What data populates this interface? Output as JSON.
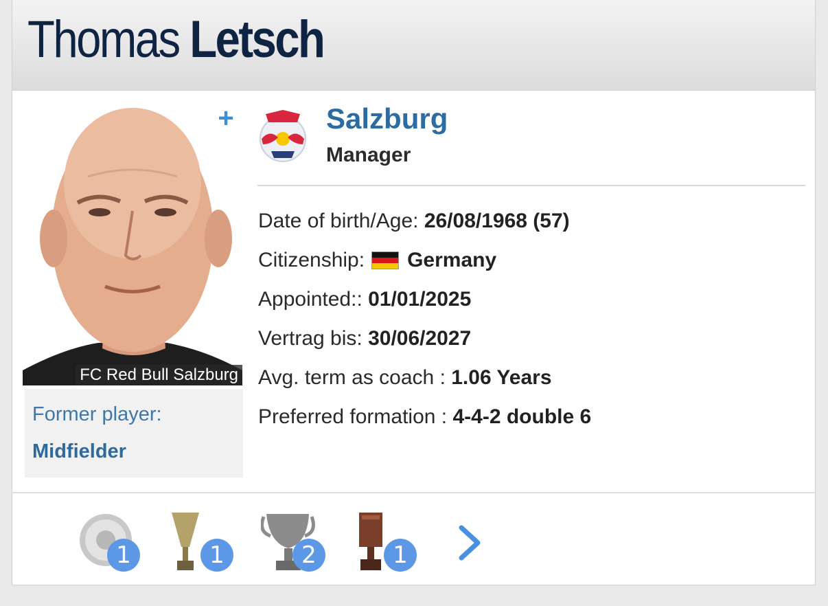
{
  "profile": {
    "first_name": "Thomas",
    "last_name": "Letsch",
    "photo_caption": "FC Red Bull Salzburg",
    "former_player_label": "Former player:",
    "former_player_position": "Midfielder"
  },
  "club": {
    "name": "Salzburg",
    "role": "Manager",
    "logo_icon": "red-bull-salzburg-crest-icon"
  },
  "info": [
    {
      "label": "Date of birth/Age:",
      "value": "26/08/1968 (57)"
    },
    {
      "label": "Citizenship:",
      "value": "Germany",
      "flag": "germany-flag-icon"
    },
    {
      "label": "Appointed::",
      "value": "01/01/2025"
    },
    {
      "label": "Vertrag bis:",
      "value": "30/06/2027"
    },
    {
      "label": "Avg. term as coach :",
      "value": "1.06 Years"
    },
    {
      "label": "Preferred formation :",
      "value": "4-4-2 double 6"
    }
  ],
  "trophies": [
    {
      "icon": "league-plate-trophy-icon",
      "count": "1"
    },
    {
      "icon": "cup-trophy-icon",
      "count": "1"
    },
    {
      "icon": "silver-cup-icon",
      "count": "2"
    },
    {
      "icon": "bronze-cup-trophy-icon",
      "count": "1"
    }
  ],
  "colors": {
    "accent": "#2d6ca2",
    "badge": "#5c98e6",
    "title": "#0f2442"
  }
}
